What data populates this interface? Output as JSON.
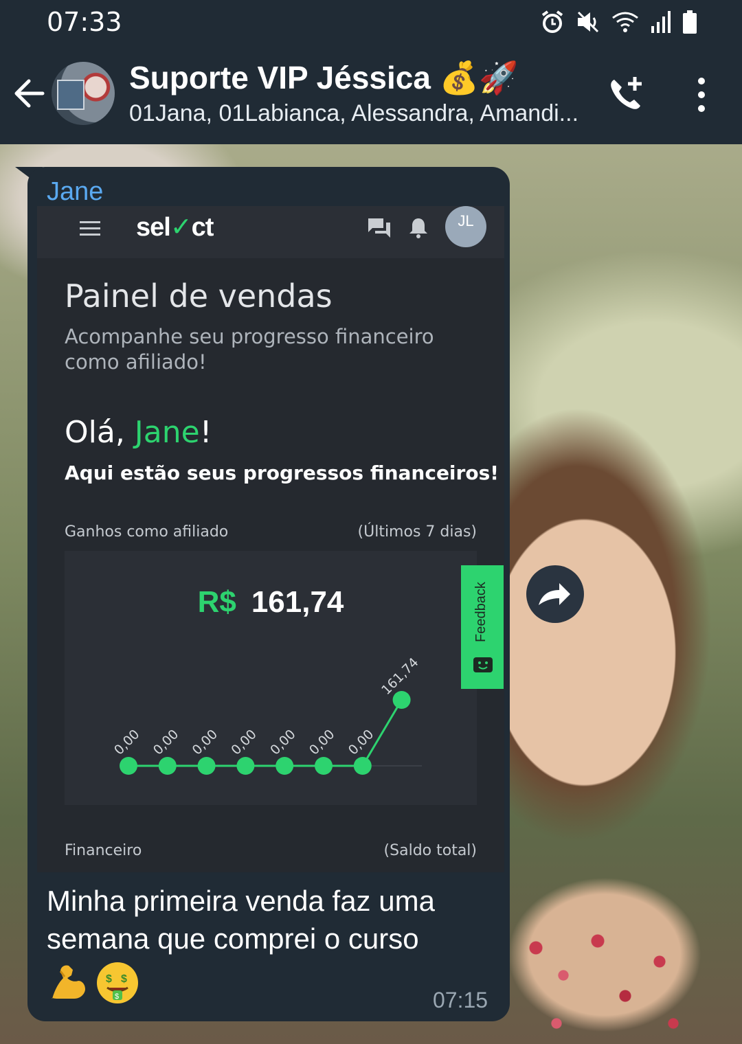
{
  "status_bar": {
    "time": "07:33",
    "icons": [
      "alarm-icon",
      "mute-icon",
      "wifi-icon",
      "signal-icon",
      "battery-icon"
    ]
  },
  "header": {
    "title": "Suporte VIP Jéssica 💰🚀",
    "subtitle": "01Jana, 01Labianca, Alessandra, Amandi...",
    "icons": [
      "back-arrow-icon",
      "add-call-icon",
      "more-vert-icon"
    ]
  },
  "message": {
    "sender": "Jane",
    "caption": "Minha primeira venda faz uma semana que comprei o curso",
    "emojis": "💪🤑",
    "time": "07:15"
  },
  "screenshot": {
    "logo": {
      "text_before": "sel",
      "check": "✓",
      "text_after": "ct"
    },
    "avatar_initials": "JL",
    "title": "Painel de vendas",
    "subtitle": "Acompanhe seu progresso financeiro como afiliado!",
    "greeting_prefix": "Olá, ",
    "greeting_name": "Jane",
    "greeting_suffix": "!",
    "greeting_sub": "Aqui estão seus progressos financeiros!",
    "section1_label": "Ganhos como afiliado",
    "section1_hint": "(Últimos 7 dias)",
    "currency": "R$",
    "total": "161,74",
    "section2_label": "Financeiro",
    "section2_hint": "(Saldo total)",
    "feedback_label": "Feedback"
  },
  "chart_data": {
    "type": "line",
    "title": "",
    "x": [
      1,
      2,
      3,
      4,
      5,
      6,
      7,
      8
    ],
    "values": [
      0,
      0,
      0,
      0,
      0,
      0,
      0,
      161.74
    ],
    "labels": [
      "0,00",
      "0,00",
      "0,00",
      "0,00",
      "0,00",
      "0,00",
      "0,00",
      "161,74"
    ],
    "color": "#2dd36f",
    "ylim": [
      0,
      161.74
    ],
    "grid": false
  },
  "colors": {
    "accent": "#2dd36f",
    "bubble": "#202b35",
    "sender": "#5aa9f0"
  }
}
